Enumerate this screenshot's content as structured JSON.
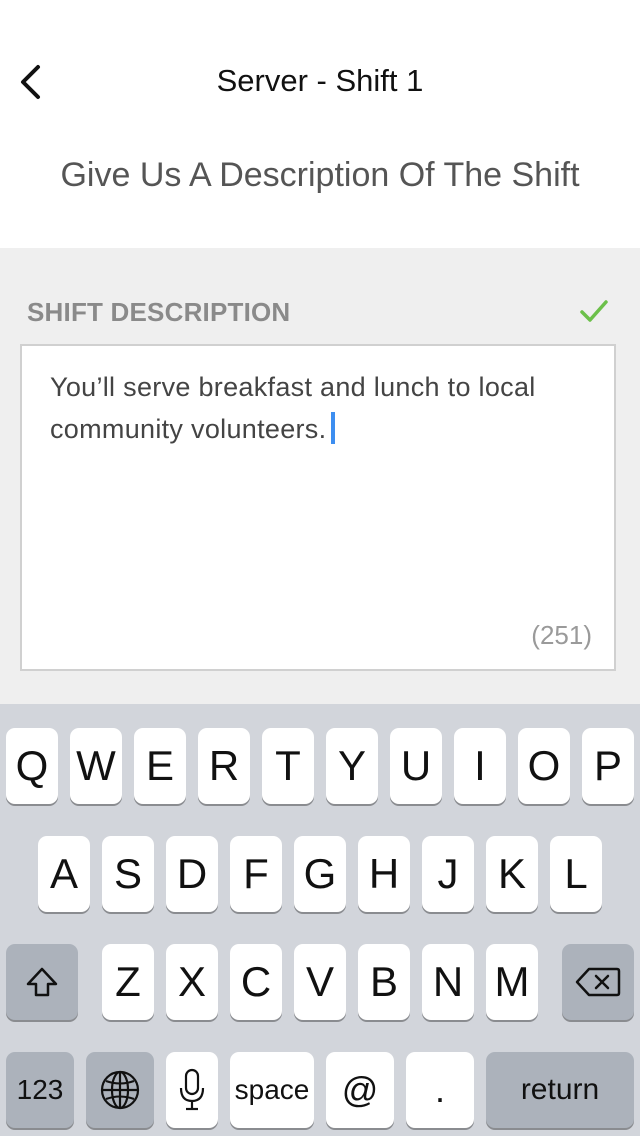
{
  "nav": {
    "title": "Server - Shift 1",
    "back_icon": "chevron-left-icon"
  },
  "subtitle": "Give Us A Description Of The Shift",
  "form": {
    "label": "SHIFT DESCRIPTION",
    "valid_icon": "checkmark-icon",
    "valid_color": "#6cc04a",
    "description_value": "You’ll serve breakfast and lunch to local community volunteers.",
    "char_count": "(251)",
    "caret_color": "#3d8ef0"
  },
  "keyboard": {
    "row1": [
      "Q",
      "W",
      "E",
      "R",
      "T",
      "Y",
      "U",
      "I",
      "O",
      "P"
    ],
    "row2": [
      "A",
      "S",
      "D",
      "F",
      "G",
      "H",
      "J",
      "K",
      "L"
    ],
    "row3": [
      "Z",
      "X",
      "C",
      "V",
      "B",
      "N",
      "M"
    ],
    "shift_icon": "shift-icon",
    "delete_icon": "delete-backspace-icon",
    "numbers_label": "123",
    "globe_icon": "globe-icon",
    "mic_icon": "microphone-icon",
    "space_label": "space",
    "at_label": "@",
    "period_label": ".",
    "return_label": "return"
  }
}
